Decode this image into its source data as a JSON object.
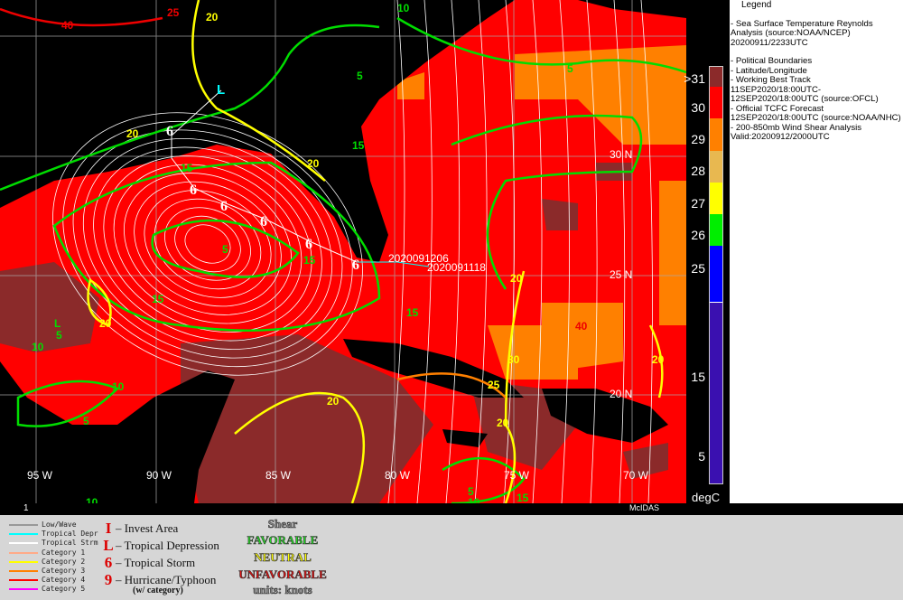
{
  "map": {
    "lat_labels": [
      "30 N",
      "25 N",
      "20 N"
    ],
    "lon_labels": [
      "95 W",
      "90 W",
      "85 W",
      "80 W",
      "75 W",
      "70 W"
    ],
    "track_times": [
      "2020091206",
      "2020091118"
    ],
    "contour_labels": [
      "40",
      "25",
      "20",
      "10",
      "5",
      "15",
      "5",
      "20",
      "15",
      "20",
      "5",
      "15",
      "20",
      "15",
      "10",
      "5",
      "10",
      "20",
      "15",
      "20",
      "30",
      "25",
      "20",
      "40",
      "20",
      "5",
      "10",
      "15",
      "L",
      "5",
      "10"
    ],
    "colors": {
      "ocean_warm": "#ff0000",
      "ocean_hot": "#8b2a2a",
      "ocean_29": "#ff8000",
      "land": "#000000",
      "favorable": "#00dd00",
      "neutral": "#ffff00",
      "streamline": "#ffffff"
    }
  },
  "strip": {
    "frame": "1",
    "brand": "McIDAS"
  },
  "colorbar": {
    "unit": "degC",
    "labels": [
      ">31",
      "30",
      "29",
      "28",
      "27",
      "26",
      "25",
      "15",
      "5"
    ],
    "colors": [
      "#8b2a2a",
      "#ff0000",
      "#ff8000",
      "#e8b850",
      "#ffff00",
      "#00ee00",
      "#0000ff",
      "#3a10b0"
    ]
  },
  "legend": {
    "title": "Legend",
    "lines": [
      "-  Sea Surface Temperature  Reynolds",
      "Analysis  (source:NOAA/NCEP)",
      "20200911/2233UTC",
      "",
      "-  Political Boundaries",
      "-  Latitude/Longitude",
      "-  Working Best Track",
      "11SEP2020/18:00UTC-",
      "12SEP2020/18:00UTC   (source:OFCL)",
      "-  Official TCFC Forecast",
      "12SEP2020/18:00UTC  (source:NOAA/NHC)",
      "-  200-850mb Wind Shear Analysis",
      "Valid:20200912/2000UTC"
    ]
  },
  "track_key": [
    {
      "label": "Low/Wave",
      "color": "#999999"
    },
    {
      "label": "Tropical Depr",
      "color": "#00ffff"
    },
    {
      "label": "Tropical Strm",
      "color": "#ffffff"
    },
    {
      "label": "Category 1",
      "color": "#ffaa88"
    },
    {
      "label": "Category 2",
      "color": "#ffff00"
    },
    {
      "label": "Category 3",
      "color": "#ff8000"
    },
    {
      "label": "Category 4",
      "color": "#ff0000"
    },
    {
      "label": "Category 5",
      "color": "#ff00ff"
    }
  ],
  "symbol_key": [
    {
      "symbol": "I",
      "label": "– Invest Area"
    },
    {
      "symbol": "L",
      "label": "– Tropical Depression"
    },
    {
      "symbol": "6",
      "label": "– Tropical Storm"
    },
    {
      "symbol": "9",
      "label": "– Hurricane/Typhoon"
    }
  ],
  "symbol_note": "(w/ category)",
  "shear_key": {
    "title": "Shear",
    "favorable": "FAVORABLE",
    "neutral": "NEUTRAL",
    "unfavorable": "UNFAVORABLE",
    "units": "units: knots"
  }
}
